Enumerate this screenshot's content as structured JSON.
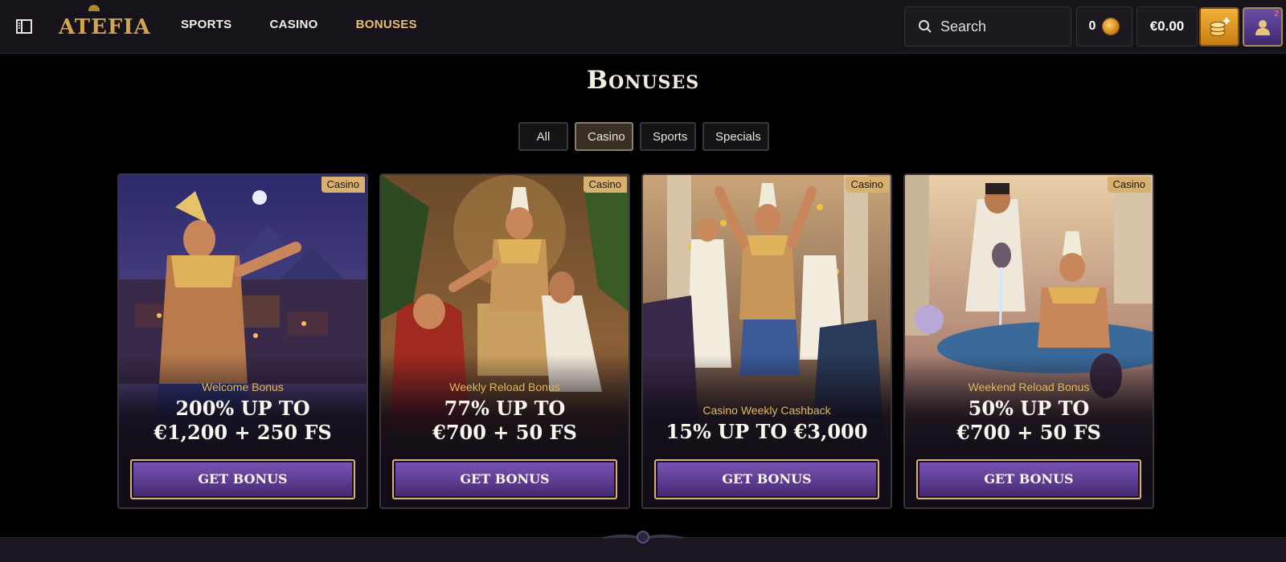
{
  "header": {
    "logo": "ATEFIA",
    "nav": [
      {
        "label": "SPORTS",
        "active": false
      },
      {
        "label": "CASINO",
        "active": false
      },
      {
        "label": "BONUSES",
        "active": true
      }
    ],
    "search_placeholder": "Search",
    "coins": "0",
    "balance": "€0.00",
    "profile_badge": "2"
  },
  "page": {
    "title": "Bonuses",
    "tabs": [
      {
        "label": "All",
        "active": false
      },
      {
        "label": "Casino",
        "active": true
      },
      {
        "label": "Sports",
        "active": false
      },
      {
        "label": "Specials",
        "active": false
      }
    ]
  },
  "cards": [
    {
      "tag": "Casino",
      "subtitle": "Welcome Bonus",
      "line1": "200% UP TO",
      "line2": "€1,200 + 250 FS",
      "cta": "GET BONUS"
    },
    {
      "tag": "Casino",
      "subtitle": "Weekly Reload Bonus",
      "line1": "77% UP TO",
      "line2": "€700 + 50 FS",
      "cta": "GET BONUS"
    },
    {
      "tag": "Casino",
      "subtitle": "Casino Weekly Cashback",
      "line1": "15% UP TO €3,000",
      "line2": "",
      "cta": "GET BONUS"
    },
    {
      "tag": "Casino",
      "subtitle": "Weekend Reload Bonus",
      "line1": "50% UP TO",
      "line2": "€700 + 50 FS",
      "cta": "GET BONUS"
    }
  ],
  "colors": {
    "accent_gold": "#e2b85f",
    "button_purple": "#7b55b8",
    "background": "#000000",
    "header_bg": "#16131a"
  }
}
